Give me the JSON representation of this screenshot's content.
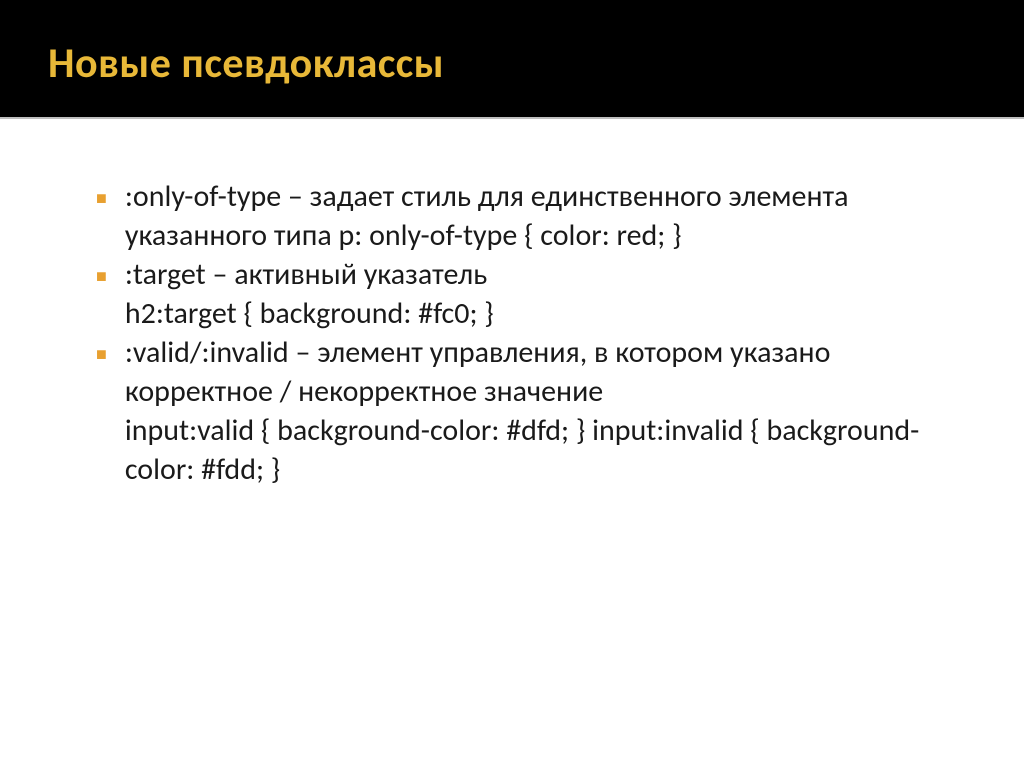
{
  "header": {
    "title": "Новые псевдоклассы"
  },
  "bullets": [
    {
      "text": ":only-of-type – задает стиль для единственного элемента указанного типа p: only-of-type { color: red; }"
    },
    {
      "text": ":target – активный указатель\n h2:target { background: #fc0; }"
    },
    {
      "text": ":valid/:invalid – элемент управления, в котором указано корректное / некорректное значение\ninput:valid { background-color: #dfd; } input:invalid { background-color: #fdd; }"
    }
  ]
}
